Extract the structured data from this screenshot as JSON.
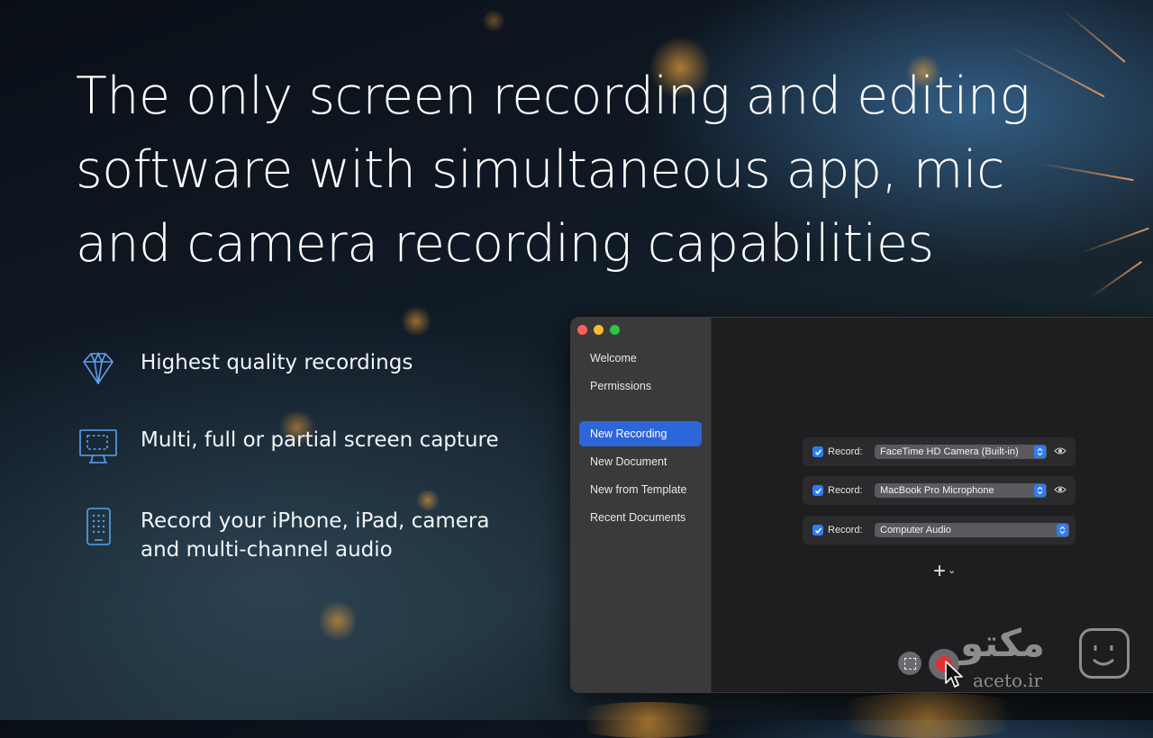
{
  "headline": {
    "line1": "The only screen recording and editing",
    "line2": "software with simultaneous app, mic",
    "line3": "and camera recording capabilities"
  },
  "features": [
    {
      "icon": "diamond-icon",
      "line1": "Highest quality recordings",
      "line2": ""
    },
    {
      "icon": "screen-selection-icon",
      "line1": "Multi, full or partial screen capture",
      "line2": ""
    },
    {
      "icon": "phone-icon",
      "line1": "Record your iPhone, iPad, camera",
      "line2": "and multi-channel audio"
    }
  ],
  "sidebar": {
    "items": [
      {
        "label": "Welcome",
        "active": false
      },
      {
        "label": "Permissions",
        "active": false
      },
      {
        "label": "New Recording",
        "active": true
      },
      {
        "label": "New Document",
        "active": false
      },
      {
        "label": "New from Template",
        "active": false
      },
      {
        "label": "Recent Documents",
        "active": false
      }
    ]
  },
  "sources": [
    {
      "label": "Record:",
      "checked": true,
      "value": "FaceTime HD Camera (Built-in)",
      "has_eye": true
    },
    {
      "label": "Record:",
      "checked": true,
      "value": "MacBook Pro Microphone",
      "has_eye": true
    },
    {
      "label": "Record:",
      "checked": true,
      "value": "Computer Audio",
      "has_eye": false
    }
  ],
  "add_source": {
    "plus": "+",
    "chevron": "⌄"
  },
  "watermark": {
    "text": "مکتو",
    "sub": "aceto.ir"
  },
  "colors": {
    "accent": "#2c66d9",
    "record_red": "#e0302f",
    "traffic_red": "#ff5f57",
    "traffic_yellow": "#febc2e",
    "traffic_green": "#28c840",
    "icon_blue": "#5aa0f0"
  }
}
